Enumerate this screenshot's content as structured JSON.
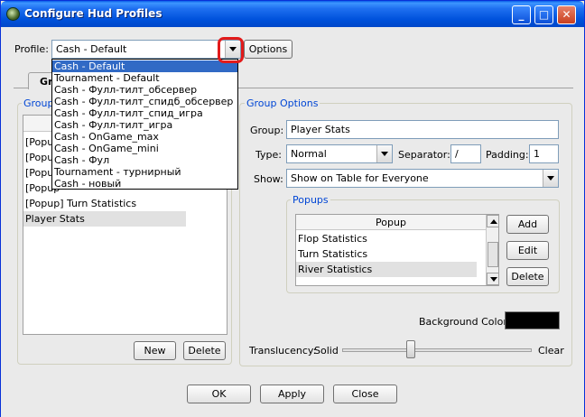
{
  "window": {
    "title": "Configure Hud Profiles"
  },
  "titlebar_buttons": {
    "minimize": "_",
    "maximize": "□",
    "close": "✕"
  },
  "profile": {
    "label": "Profile:",
    "value": "Cash - Default",
    "options_button": "Options",
    "dropdown_items": [
      "Cash - Default",
      "Tournament - Default",
      "Cash - Фулл-тилт_обсервер",
      "Cash - Фулл-тилт_спидб_обсервер",
      "Cash - Фулл-тилт_спид_игра",
      "Cash - Фулл-тилт_игра",
      "Cash - OnGame_max",
      "Cash - OnGame_mini",
      "Cash - Фул",
      "Tournament - турнирный",
      "Cash - новый"
    ]
  },
  "tabs": {
    "active": "Gr"
  },
  "groups": {
    "title": "Groups",
    "items": [
      "[Popup",
      "[Popup",
      "[Popup",
      "[Popup",
      "[Popup] Turn Statistics",
      "Player Stats"
    ],
    "new_button": "New",
    "delete_button": "Delete"
  },
  "group_options": {
    "title": "Group Options",
    "group_label": "Group:",
    "group_value": "Player Stats",
    "type_label": "Type:",
    "type_value": "Normal",
    "separator_label": "Separator:",
    "separator_value": "/",
    "padding_label": "Padding:",
    "padding_value": "1",
    "show_label": "Show:",
    "show_value": "Show on Table for Everyone"
  },
  "popups": {
    "title": "Popups",
    "column_header": "Popup",
    "items": [
      "Flop Statistics",
      "Turn Statistics",
      "River Statistics"
    ],
    "add_button": "Add",
    "edit_button": "Edit",
    "delete_button": "Delete"
  },
  "background": {
    "label": "Background Color:",
    "color": "#000000"
  },
  "translucency": {
    "label": "Translucency:",
    "min_label": "Solid",
    "max_label": "Clear",
    "value_fraction": 0.36
  },
  "footer": {
    "ok": "OK",
    "apply": "Apply",
    "close": "Close"
  },
  "colors": {
    "title_bar": "#0054E3",
    "selection": "#316AC5",
    "group_title": "#0046D5",
    "highlight_circle": "#E21B1B"
  }
}
